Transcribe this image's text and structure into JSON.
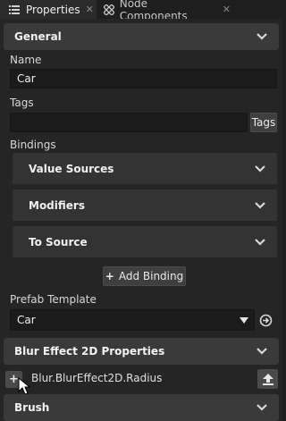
{
  "tabs": [
    {
      "label": "Properties",
      "icon": "list-icon",
      "active": true
    },
    {
      "label": "Node Components",
      "icon": "components-icon",
      "active": false
    }
  ],
  "general": {
    "title": "General",
    "name_label": "Name",
    "name_value": "Car",
    "tags_label": "Tags",
    "tags_value": "",
    "tags_button": "Tags",
    "bindings_label": "Bindings",
    "subsections": [
      "Value Sources",
      "Modifiers",
      "To Source"
    ],
    "add_binding": "Add Binding",
    "prefab_label": "Prefab Template",
    "prefab_value": "Car"
  },
  "blur_section": {
    "title": "Blur Effect 2D Properties",
    "property": "Blur.BlurEffect2D.Radius"
  },
  "brush_section": {
    "title": "Brush"
  },
  "colors": {
    "panel_bg": "#252525",
    "section_bg": "#3a3a3a",
    "field_bg": "#1b1b1b"
  }
}
